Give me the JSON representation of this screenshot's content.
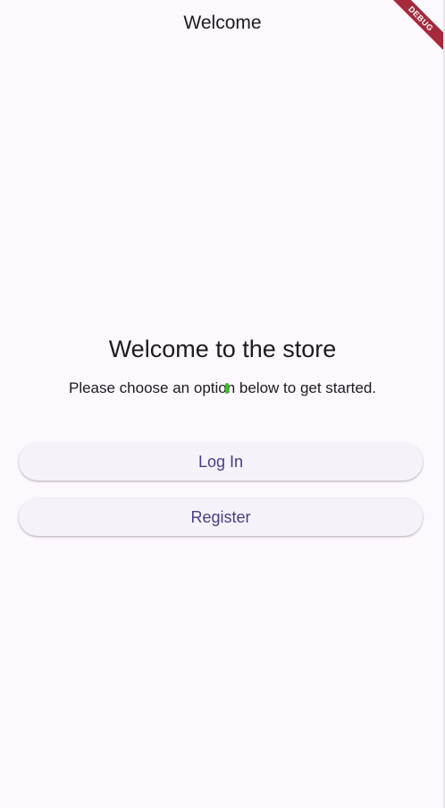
{
  "app_bar": {
    "title": "Welcome"
  },
  "debug_banner": {
    "label": "DEBUG",
    "color": "#a52a3a"
  },
  "main": {
    "headline": "Welcome to the store",
    "subtitle": "Please choose an option below to get started."
  },
  "actions": {
    "login_label": "Log In",
    "register_label": "Register"
  },
  "colors": {
    "background": "#fdf7fe",
    "button_surface": "#f7f2fa",
    "button_text": "#4a3c86",
    "text_primary": "#1d1b20"
  }
}
